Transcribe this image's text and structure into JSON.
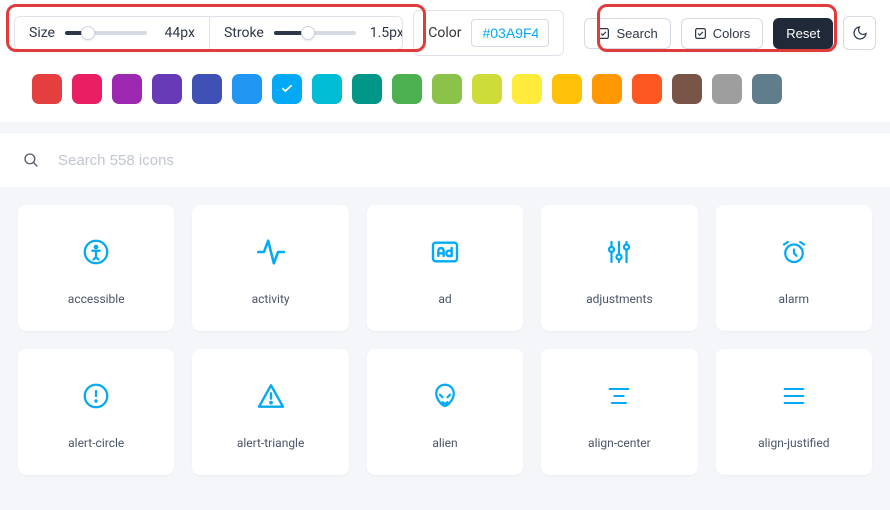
{
  "toolbar": {
    "size": {
      "label": "Size",
      "value": "44px",
      "percent": 28
    },
    "stroke": {
      "label": "Stroke",
      "value": "1.5px",
      "percent": 42
    },
    "color": {
      "label": "Color",
      "value": "#03A9F4"
    },
    "search_btn": "Search",
    "colors_btn": "Colors",
    "reset_btn": "Reset"
  },
  "palette": [
    {
      "hex": "#e53e3e"
    },
    {
      "hex": "#e91e63"
    },
    {
      "hex": "#9c27b0"
    },
    {
      "hex": "#673ab7"
    },
    {
      "hex": "#3f51b5"
    },
    {
      "hex": "#2196f3"
    },
    {
      "hex": "#03a9f4",
      "selected": true
    },
    {
      "hex": "#00bcd4"
    },
    {
      "hex": "#009688"
    },
    {
      "hex": "#4caf50"
    },
    {
      "hex": "#8bc34a"
    },
    {
      "hex": "#cddc39"
    },
    {
      "hex": "#ffeb3b"
    },
    {
      "hex": "#ffc107"
    },
    {
      "hex": "#ff9800"
    },
    {
      "hex": "#ff5722"
    },
    {
      "hex": "#795548"
    },
    {
      "hex": "#9e9e9e"
    },
    {
      "hex": "#607d8b"
    }
  ],
  "search": {
    "placeholder": "Search 558 icons"
  },
  "icons": [
    {
      "id": "accessible",
      "label": "accessible"
    },
    {
      "id": "activity",
      "label": "activity"
    },
    {
      "id": "ad",
      "label": "ad"
    },
    {
      "id": "adjustments",
      "label": "adjustments"
    },
    {
      "id": "alarm",
      "label": "alarm"
    },
    {
      "id": "alert-circle",
      "label": "alert-circle"
    },
    {
      "id": "alert-triangle",
      "label": "alert-triangle"
    },
    {
      "id": "alien",
      "label": "alien"
    },
    {
      "id": "align-center",
      "label": "align-center"
    },
    {
      "id": "align-justified",
      "label": "align-justified"
    }
  ],
  "accent": "#03A9F4"
}
